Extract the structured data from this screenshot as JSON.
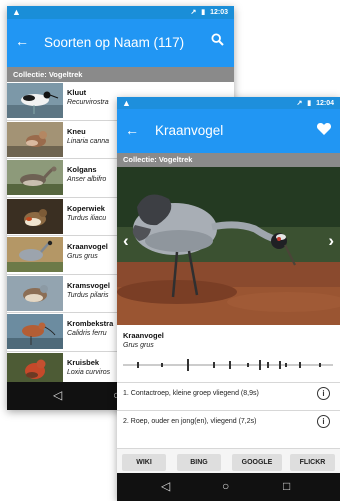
{
  "back_screen": {
    "status": {
      "time": "12:03",
      "signal": "↗",
      "battery": "▮"
    },
    "appbar": {
      "title": "Soorten op Naam (117)"
    },
    "collection": "Collectie: Vogeltrek",
    "species": [
      {
        "name": "Kluut",
        "sci": "Recurvirostra"
      },
      {
        "name": "Kneu",
        "sci": "Linaria canna"
      },
      {
        "name": "Kolgans",
        "sci": "Anser albifro"
      },
      {
        "name": "Koperwiek",
        "sci": "Turdus iliacu"
      },
      {
        "name": "Kraanvogel",
        "sci": "Grus grus"
      },
      {
        "name": "Kramsvogel",
        "sci": "Turdus pilaris"
      },
      {
        "name": "Krombekstra",
        "sci": "Calidris ferru"
      },
      {
        "name": "Kruisbek",
        "sci": "Loxia curviros"
      }
    ]
  },
  "front_screen": {
    "status": {
      "time": "12:04",
      "signal": "↗",
      "battery": "▮"
    },
    "appbar": {
      "title": "Kraanvogel"
    },
    "collection": "Collectie: Vogeltrek",
    "bird": {
      "name": "Kraanvogel",
      "sci": "Grus grus"
    },
    "sounds": [
      "1. Contactroep, kleine groep vliegend (8,9s)",
      "2. Roep, ouder en jong(en), vliegend (7,2s)"
    ],
    "buttons": [
      "WIKI",
      "BING",
      "GOOGLE",
      "FLICKR"
    ]
  },
  "colors": {
    "primary": "#2196f3",
    "status": "#1e8fdc",
    "collection_bar": "#8a8a8a"
  }
}
